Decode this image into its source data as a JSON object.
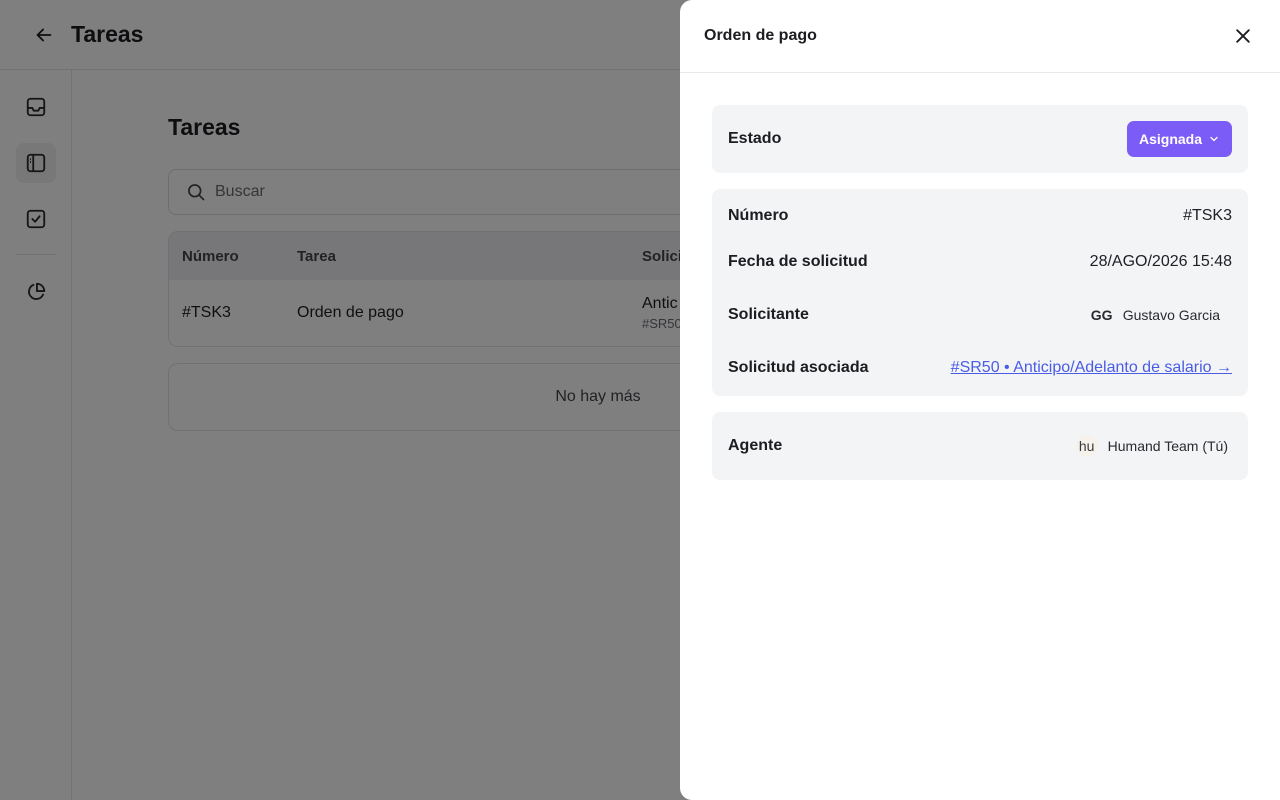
{
  "header": {
    "title": "Tareas"
  },
  "sidebar": {
    "items": [
      {
        "icon": "inbox-icon"
      },
      {
        "icon": "sidebar-panel-icon",
        "active": true
      },
      {
        "icon": "checkbox-icon"
      },
      {
        "icon": "pie-chart-icon"
      }
    ]
  },
  "main": {
    "title": "Tareas",
    "search": {
      "placeholder": "Buscar",
      "value": ""
    },
    "table": {
      "columns": [
        "Número",
        "Tarea",
        "Solici"
      ],
      "rows": [
        {
          "number": "#TSK3",
          "task": "Orden de pago",
          "request_main": "Antic",
          "request_sub": "#SR50"
        }
      ]
    },
    "empty_message": "No hay más"
  },
  "drawer": {
    "title": "Orden de pago",
    "status": {
      "label": "Estado",
      "value": "Asignada",
      "color": "#7c5cf6"
    },
    "fields": {
      "number": {
        "label": "Número",
        "value": "#TSK3"
      },
      "date": {
        "label": "Fecha de solicitud",
        "value": "28/AGO/2026 15:48"
      },
      "requester": {
        "label": "Solicitante",
        "initials": "GG",
        "name": "Gustavo Garcia"
      },
      "related": {
        "label": "Solicitud asociada",
        "value": "#SR50 • Anticipo/Adelanto de salario →",
        "color": "#4a5ce6"
      }
    },
    "agent": {
      "label": "Agente",
      "logo": "hu",
      "name": "Humand Team (Tú)"
    }
  }
}
